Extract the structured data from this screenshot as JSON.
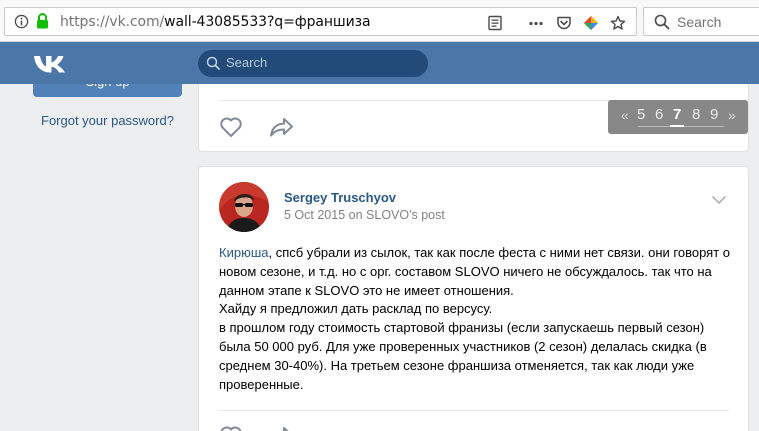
{
  "browser": {
    "url_main": "https://vk.com/",
    "url_path": "wall-43085533?q=франшиза",
    "search_placeholder": "Search"
  },
  "vk": {
    "search_placeholder": "Search",
    "signup_label": "Sign up",
    "forgot_password": "Forgot your password?"
  },
  "pagination": {
    "prev": "«",
    "pages": [
      "5",
      "6",
      "7",
      "8",
      "9"
    ],
    "current": "7",
    "next": "»"
  },
  "post": {
    "author": "Sergey Truschyov",
    "date": "5 Oct 2015",
    "on": "on",
    "context": "SLOVO's post",
    "mention": "Кирюша",
    "line1": ", спсб убрали из сылок, так как после феста с ними нет связи. они говорят о новом сезоне, и т.д. но с орг. составом SLOVO ничего не обсуждалось. так что на данном этапе к SLOVO это не имеет отношения.",
    "line2": "Хайду я предложил дать расклад по версусу.",
    "line3": "в прошлом году стоимость стартовой франизы (если запускаешь первый сезон) была 50 000 руб. Для уже проверенных участников (2 сезон) делалась скидка (в среднем 30-40%). На третьем сезоне франшиза отменяется, так как люди уже проверенные."
  },
  "colors": {
    "vk_blue": "#4a76a8",
    "link": "#2a5885",
    "background": "#edeef0"
  },
  "icons": [
    "info-icon",
    "lock-icon",
    "reader-icon",
    "more-icon",
    "pocket-icon",
    "extension-icon",
    "star-icon",
    "search-icon",
    "vk-logo",
    "like-icon",
    "share-icon",
    "chevron-down-icon"
  ]
}
